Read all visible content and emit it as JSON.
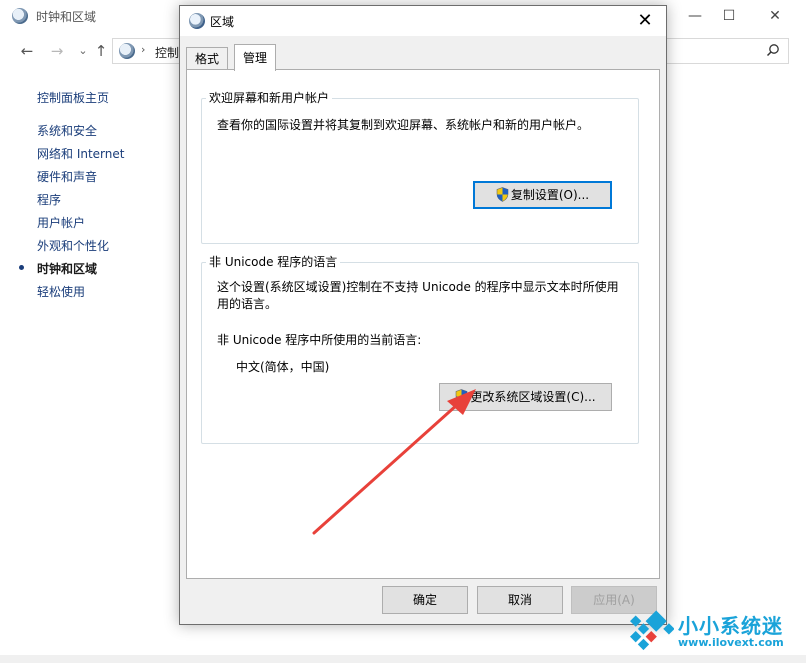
{
  "background_window": {
    "title": "时钟和区域",
    "controls": {
      "minimize": "—",
      "maximize": "☐",
      "close": "✕"
    },
    "nav": {
      "back": "←",
      "forward": "→",
      "down": "⌄",
      "up": "↑"
    },
    "address": {
      "separator": "›",
      "text": "控制"
    },
    "sidebar": {
      "home": "控制面板主页",
      "items": [
        {
          "label": "系统和安全"
        },
        {
          "label": "网络和 Internet"
        },
        {
          "label": "硬件和声音"
        },
        {
          "label": "程序"
        },
        {
          "label": "用户帐户"
        },
        {
          "label": "外观和个性化"
        },
        {
          "label": "时钟和区域",
          "active": true
        },
        {
          "label": "轻松使用"
        }
      ]
    }
  },
  "dialog": {
    "title": "区域",
    "close_glyph": "✕",
    "tabs": [
      {
        "label": "格式",
        "active": false
      },
      {
        "label": "管理",
        "active": true
      }
    ],
    "welcome_group": {
      "title": "欢迎屏幕和新用户帐户",
      "description": "查看你的国际设置并将其复制到欢迎屏幕、系统帐户和新的用户帐户。",
      "button": "复制设置(O)..."
    },
    "unicode_group": {
      "title": "非 Unicode 程序的语言",
      "description_line1": "这个设置(系统区域设置)控制在不支持 Unicode 的程序中显示文本时所使用",
      "description_line2": "用的语言。",
      "current_label": "非 Unicode 程序中所使用的当前语言:",
      "current_value": "中文(简体，中国)",
      "button": "更改系统区域设置(C)..."
    },
    "footer": {
      "ok": "确定",
      "cancel": "取消",
      "apply": "应用(A)"
    }
  },
  "watermark": {
    "text": "小小系统迷",
    "url": "www.ilovext.com"
  },
  "colors": {
    "accent": "#0078d7",
    "arrow": "#e8413a",
    "watermark": "#1aa3d9",
    "link": "#1a3d7a"
  }
}
